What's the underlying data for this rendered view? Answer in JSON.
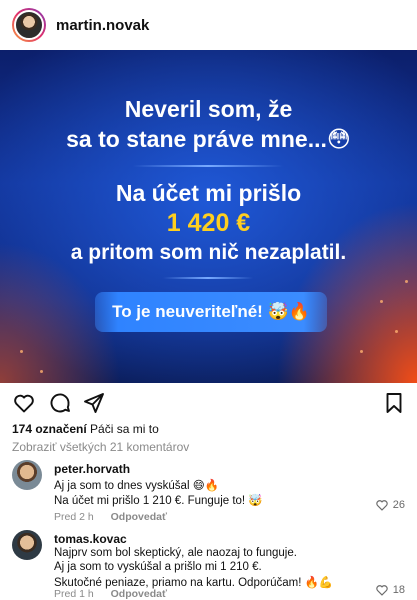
{
  "header": {
    "username": "martin.novak"
  },
  "post": {
    "line1": "Neveril som, že",
    "line2": "sa to stane práve mne...😳",
    "line3": "Na účet mi prišlo",
    "amount": "1 420 €",
    "line4": "a pritom som nič nezaplatil.",
    "cta": "To je neuveriteľné! 🤯🔥"
  },
  "likes": {
    "count": "174 označení",
    "text": "Páči sa mi to"
  },
  "view_all": "Zobraziť všetkých 21 komentárov",
  "comments": [
    {
      "user": "peter.horvath",
      "lines": [
        "Aj ja som to dnes vyskúšal 😄🔥",
        "Na účet mi prišlo 1 210 €. Funguje to! 🤯"
      ],
      "time": "Pred 2 h",
      "reply": "Odpovedať",
      "likes": "26"
    },
    {
      "user": "tomas.kovac",
      "lines": [
        "Najprv som bol skeptický, ale naozaj to funguje.",
        "Aj ja som to vyskúšal a prišlo mi 1 210 €.",
        "Skutočné peniaze, priamo na kartu. Odporúčam! 🔥💪"
      ],
      "time": "Pred 1 h",
      "reply": "Odpovedať",
      "likes": "18"
    }
  ],
  "colors": {
    "amount": "#ffcf1f",
    "cta": "#3b8cff",
    "background": "#123397"
  },
  "icons": [
    "heart-icon",
    "comment-icon",
    "share-icon",
    "bookmark-icon"
  ]
}
